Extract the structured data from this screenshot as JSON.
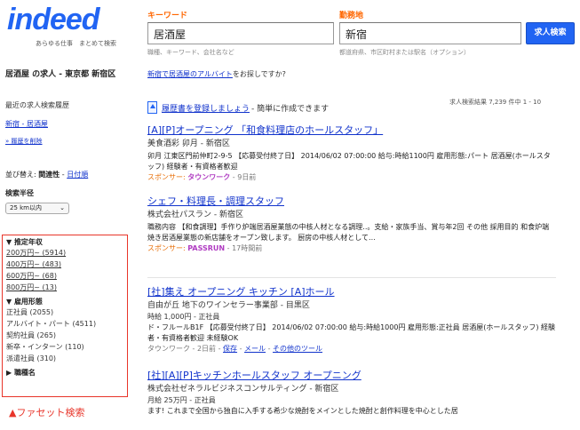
{
  "header": {
    "logo_text": "indeed",
    "logo_tagline": "あらゆる仕事　まとめて検索",
    "what_label": "キーワード",
    "what_value": "居酒屋",
    "what_hint": "職種、キーワード、会社名など",
    "where_label": "勤務地",
    "where_value": "新宿",
    "where_hint": "都道府県、市区町村または駅名（オプション）",
    "search_button": "求人検索"
  },
  "sidebar": {
    "title": "居酒屋 の求人 - 東京都 新宿区",
    "recent_heading": "最近の求人検索履歴",
    "recent_link": "新宿 - 居酒屋",
    "recent_clear": "» 履歴を削除",
    "sort_prefix": "並び替え:",
    "sort_active": "関連性",
    "sort_separator": " - ",
    "sort_link": "日付順",
    "radius_label": "検索半径",
    "radius_value": "25 km以内",
    "radius_arrow": "⌄"
  },
  "facets": {
    "salary": {
      "heading": "▼ 推定年収",
      "items": [
        "200万円~ (5914)",
        "400万円~ (483)",
        "600万円~ (68)",
        "800万円~ (13)"
      ]
    },
    "employment": {
      "heading": "▼ 雇用形態",
      "items": [
        "正社員 (2055)",
        "アルバイト・パート (4511)",
        "契約社員 (265)",
        "新卒・インターン (110)",
        "派遣社員 (310)"
      ]
    },
    "category": {
      "heading": "▶ 職種名"
    },
    "caption": "▲ファセット検索",
    "box_color": "#e8352a"
  },
  "main": {
    "suggest_link": "新宿で居酒屋のアルバイト",
    "suggest_rest": "をお探しですか?",
    "result_count": "求人検索結果 7,239 件中 1 - 10",
    "resume_link": "履歴書を登録しましょう",
    "resume_rest": " - 簡単に作成できます"
  },
  "jobs": [
    {
      "title": "[A][P]オープニング 「和食料理店のホールスタッフ」",
      "company": "美食酒彩 卯月 - 新宿区",
      "snippet": "卯月 江東区門前仲町2-9-5 【応募受付終了日】 2014/06/02 07:00:00 給与:時給1100円 雇用形態:パート 居酒屋(ホールスタッフ) 経験者・有資格者歓迎",
      "sponsor_label": "スポンサー: ",
      "sponsor_name": "タウンワーク",
      "age": " - 9日前"
    },
    {
      "title": "シェフ・料理長・調理スタッフ",
      "company": "株式会社パスラン - 新宿区",
      "snippet": "職務内容 【和食調理】手作り炉端居酒屋業態の中核人材となる調理..。支給・家族手当、賞与年2回 その他 採用目的 和食炉端焼き居酒屋業態の新店舗をオープン致します。 厨房の中核人材として...",
      "sponsor_label": "スポンサー: ",
      "sponsor_name": "PASSRUN",
      "age": " - 17時間前"
    },
    {
      "title": "[社]集え オープニング キッチン [A]ホール",
      "company": "自由が丘 地下のワインセラー事業部 - 目黒区",
      "salary": "時給 1,000円 - 正社員",
      "snippet": "ド・フルールB1F 【応募受付終了日】 2014/06/02 07:00:00 給与:時給1000円 雇用形態:正社員 居酒屋(ホールスタッフ) 経験者・有資格者歓迎 未経験OK",
      "meta_source": "タウンワーク - 2日前 - ",
      "meta_save": "保存",
      "meta_sep1": " - ",
      "meta_mail": "メール",
      "meta_sep2": " - ",
      "meta_more": "その他のツール"
    },
    {
      "title": "[社][A][P]キッチンホールスタッフ オープニング",
      "company": "株式会社ゼネラルビジネスコンサルティング - 新宿区",
      "salary": "月給 25万円 - 正社員",
      "snippet": "ます! これまで全国から独自に入手する希少な焼酎をメインとした焼酎と創作料理を中心とした居"
    }
  ]
}
